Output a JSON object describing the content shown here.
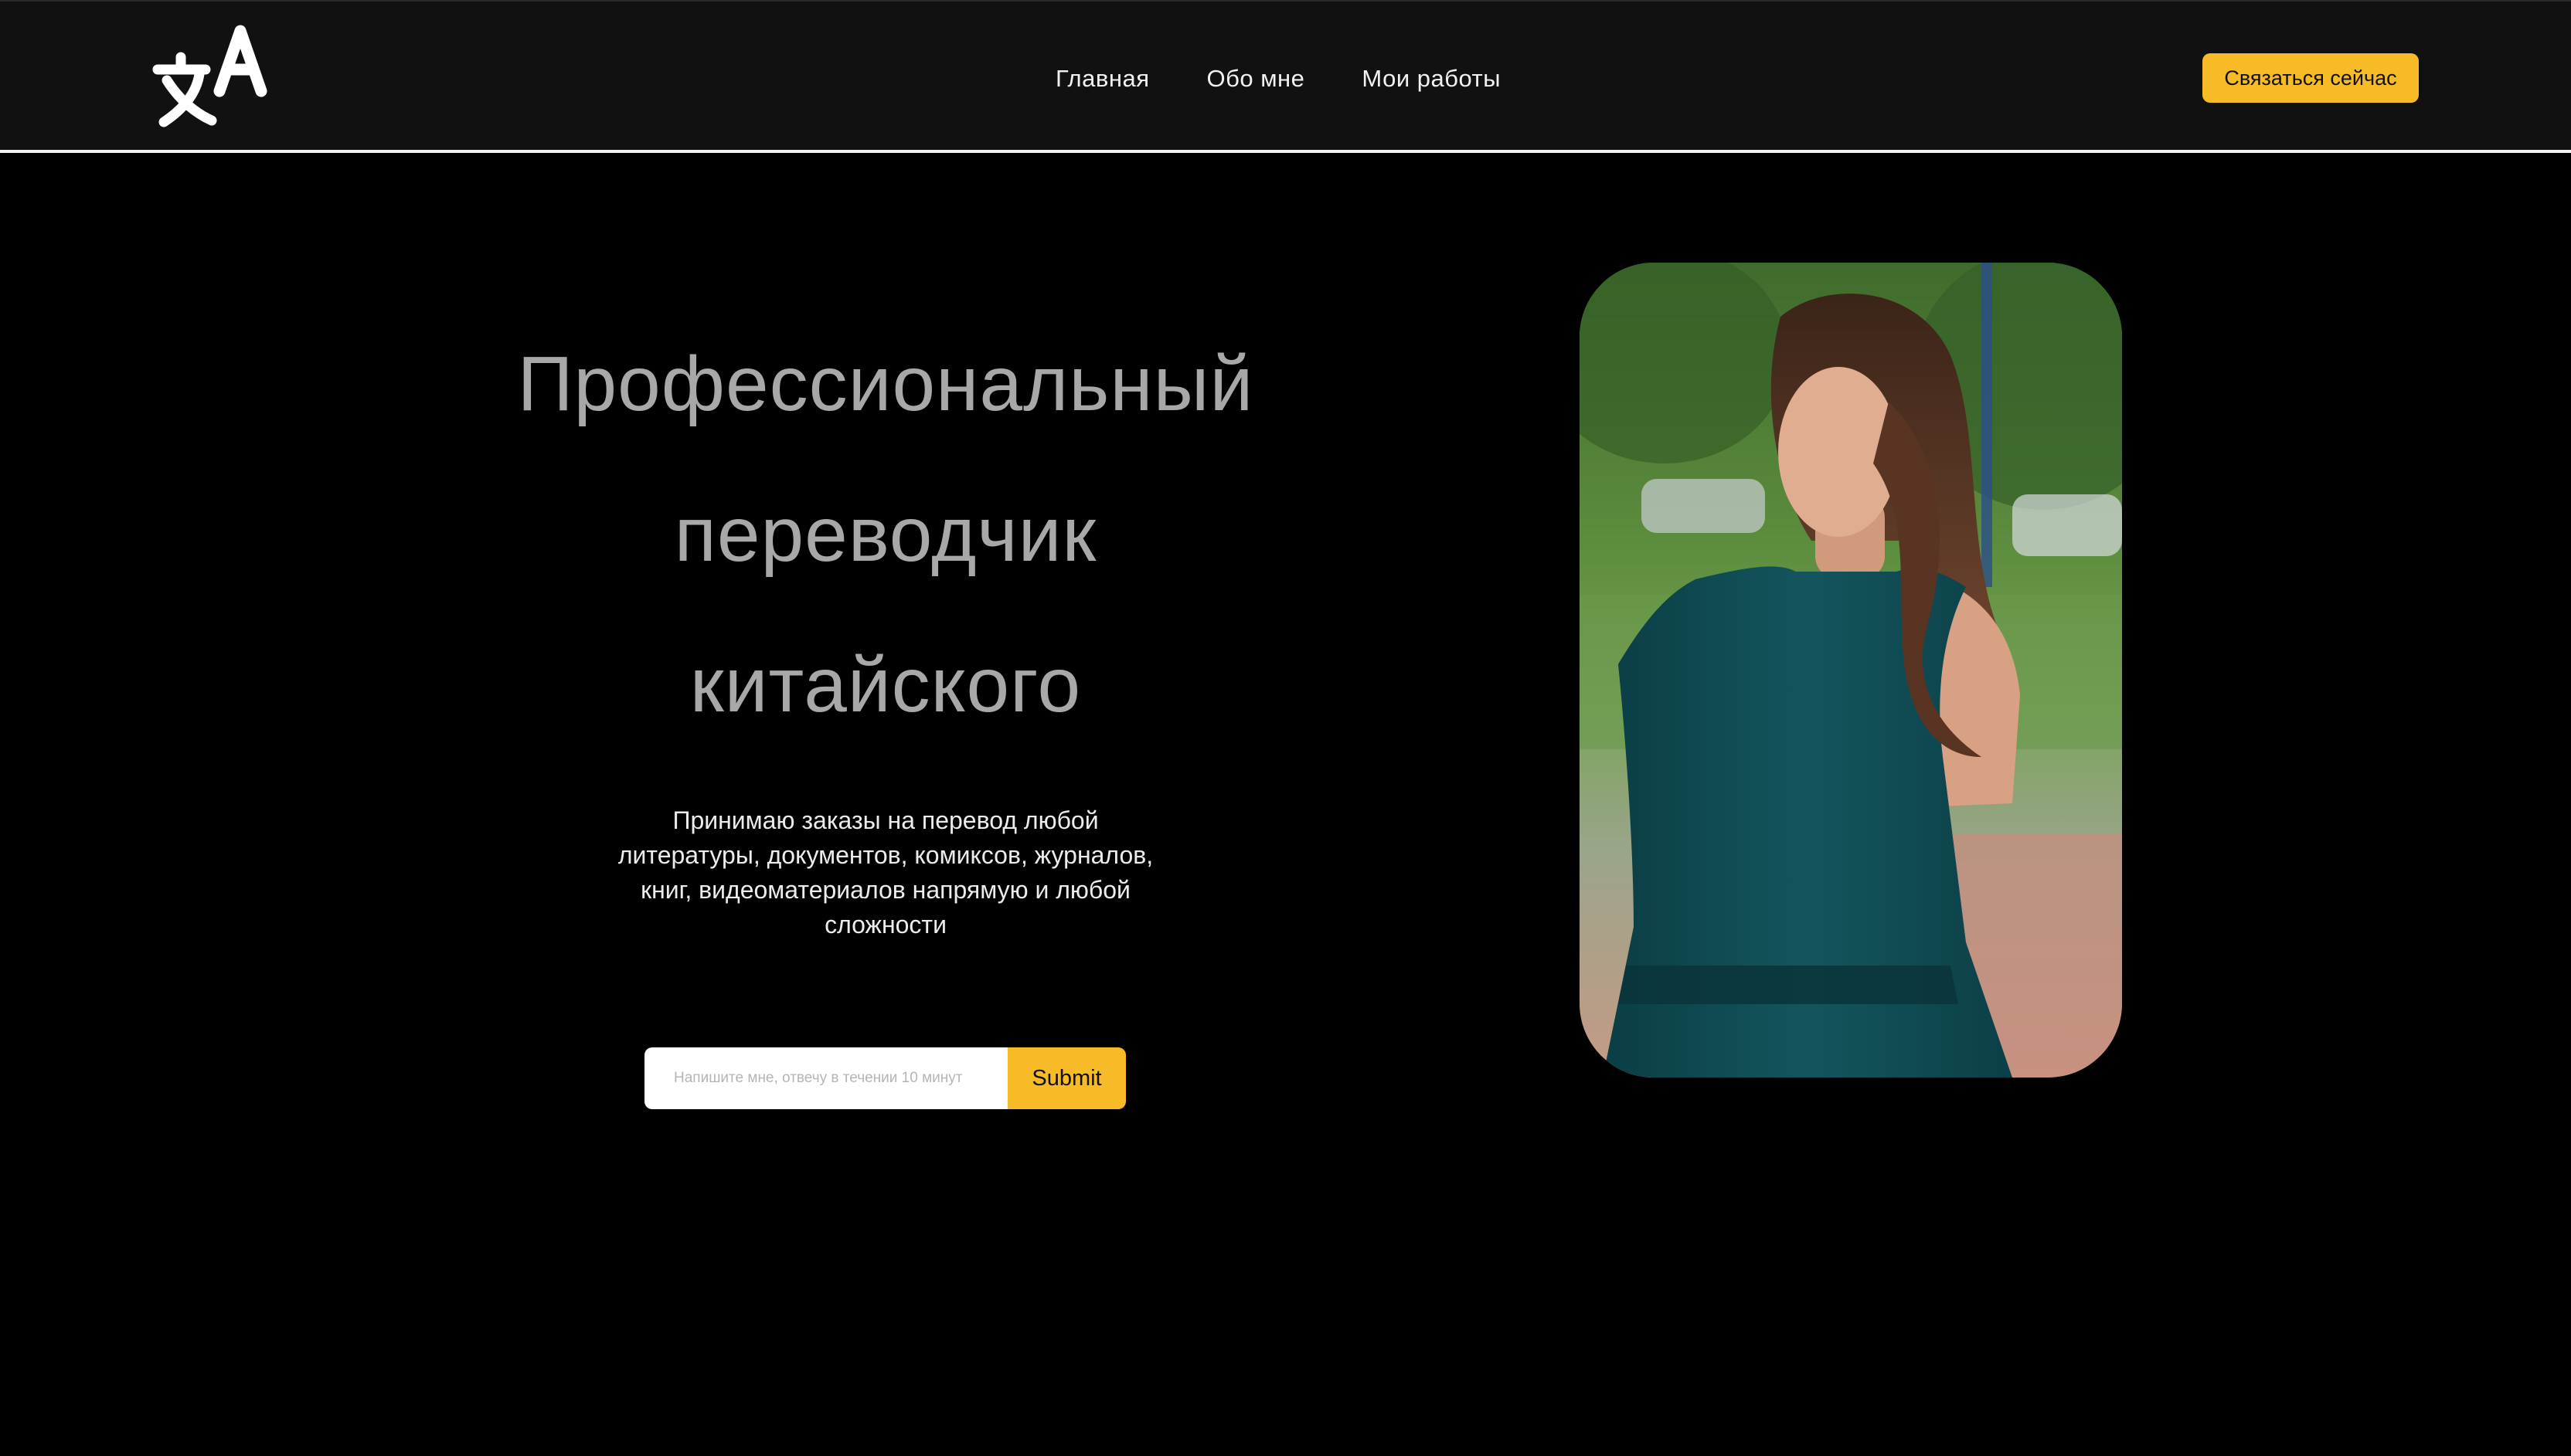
{
  "header": {
    "logo_icon": "translate-icon",
    "nav": [
      {
        "label": "Главная"
      },
      {
        "label": "Обо мне"
      },
      {
        "label": "Мои работы"
      }
    ],
    "cta_label": "Связаться сейчас",
    "accent_color": "#f6bb27"
  },
  "hero": {
    "title_lines": [
      "Профессиональный",
      "переводчик",
      "китайского"
    ],
    "description": "Принимаю заказы на перевод любой литературы, документов, комиксов, журналов, книг, видеоматериалов напрямую и любой сложности",
    "input_placeholder": "Напишите мне, отвечу в течении 10 минут",
    "submit_label": "Submit"
  }
}
